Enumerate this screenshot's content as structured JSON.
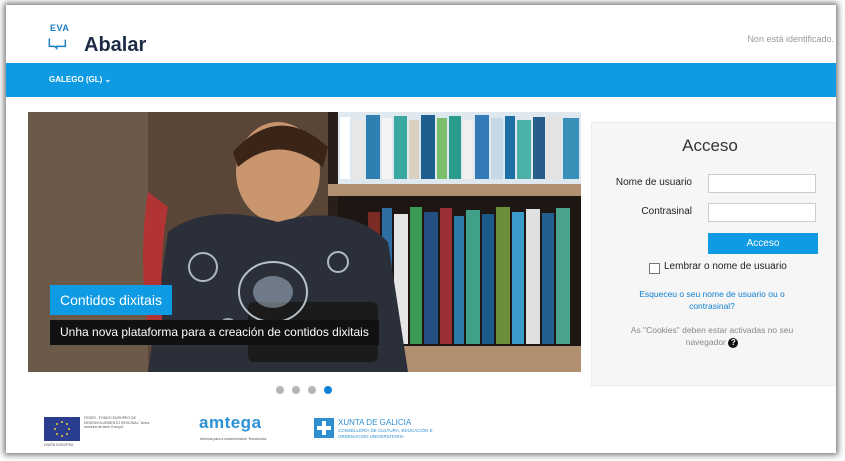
{
  "header": {
    "logo_small": "EVA",
    "logo_name": "Abalar",
    "login_status": "Non está identificado."
  },
  "navbar": {
    "language": "GALEGO (GL) ⌄"
  },
  "slider": {
    "caption_title": "Contidos dixitais",
    "caption_text": "Unha nova plataforma para a creación de contidos dixitais",
    "slide_count": 4,
    "active_slide": 4
  },
  "login": {
    "title": "Acceso",
    "username_label": "Nome de usuario",
    "username_value": "",
    "password_label": "Contrasinal",
    "password_value": "",
    "submit_label": "Acceso",
    "remember_label": "Lembrar o nome de usuario",
    "remember_checked": false,
    "forgot_link": "Esqueceu o seu nome de usuario ou o contrasinal?",
    "cookies_note": "As \"Cookies\" deben estar activadas no seu navegador",
    "help_icon_glyph": "?"
  },
  "footer": {
    "eu_text": "FEDER - FONDO EUROPEO DE DESENVOLVEMENTO REXIONAL \"Unha maneira de facer Europa\"",
    "eu_caption": "UNIÓN EUROPEA",
    "amtega": "amtega",
    "amtega_sub": "Axencia para a modernización Tecnolóxica",
    "xunta_title": "XUNTA DE GALICIA",
    "xunta_sub": "CONSELLERÍA DE CULTURA, EDUCACIÓN E ORDENACIÓN UNIVERSITARIA"
  },
  "colors": {
    "accent": "#0f9be3",
    "link": "#0f7fcf",
    "dot_active": "#0f7fcf",
    "dot_inactive": "#b5b5b5"
  }
}
